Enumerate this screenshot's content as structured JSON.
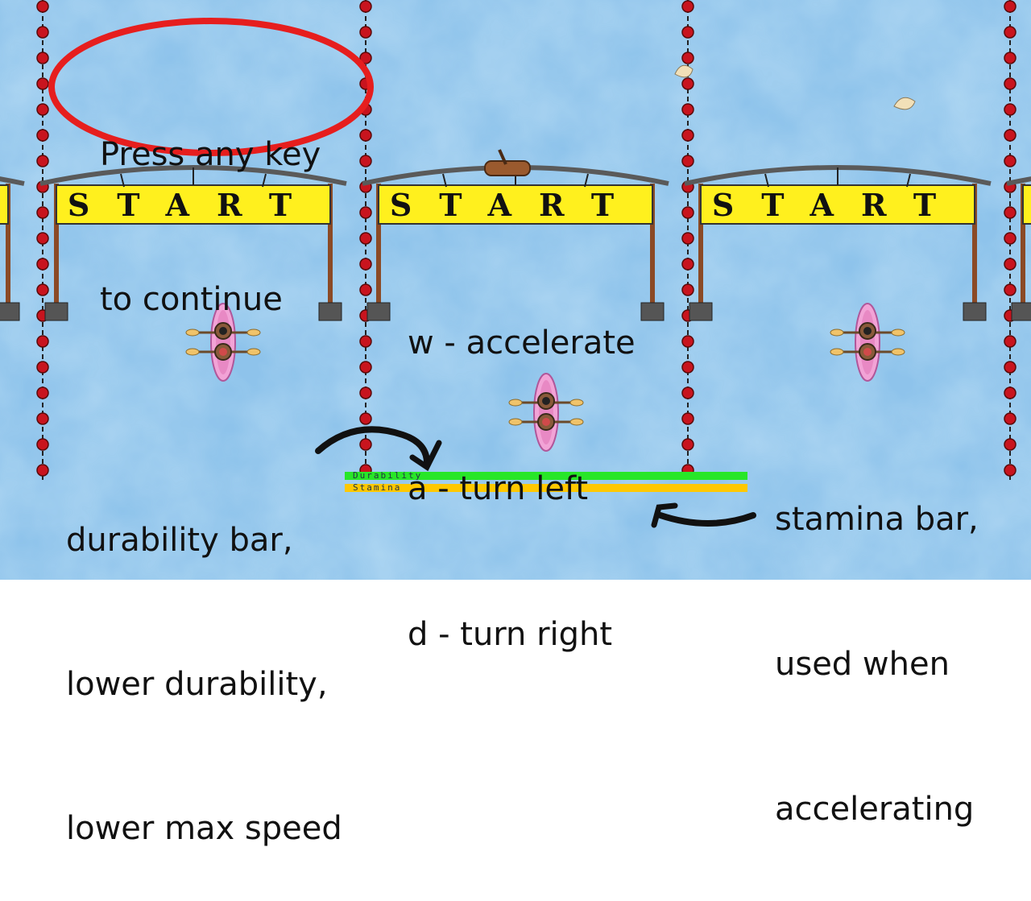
{
  "overlay": {
    "press_any_key": [
      "Press any key",
      "to continue"
    ],
    "controls": [
      "w - accelerate",
      "a - turn left",
      "d - turn right"
    ],
    "durability_note": [
      "durability bar,",
      "lower durability,",
      "lower max speed"
    ],
    "stamina_note": [
      "stamina bar,",
      "used when",
      "accelerating"
    ]
  },
  "hud": {
    "durability_label": "Durability",
    "stamina_label": "Stamina",
    "durability_fraction": 1.0,
    "stamina_fraction": 1.0
  },
  "course": {
    "banner_text": "START",
    "banner_count": 3,
    "lane_count": 3
  },
  "colors": {
    "water": "#8ec3eb",
    "banner": "#fff01e",
    "buoy": "#c8141e",
    "boat": "#f2a3d6",
    "durability": "#28e628",
    "stamina": "#ffc800",
    "circle": "#e61e1e"
  },
  "icons": [
    "kayak-icon",
    "log-icon",
    "duck-icon",
    "start-banner-icon",
    "buoy-rope-icon"
  ]
}
